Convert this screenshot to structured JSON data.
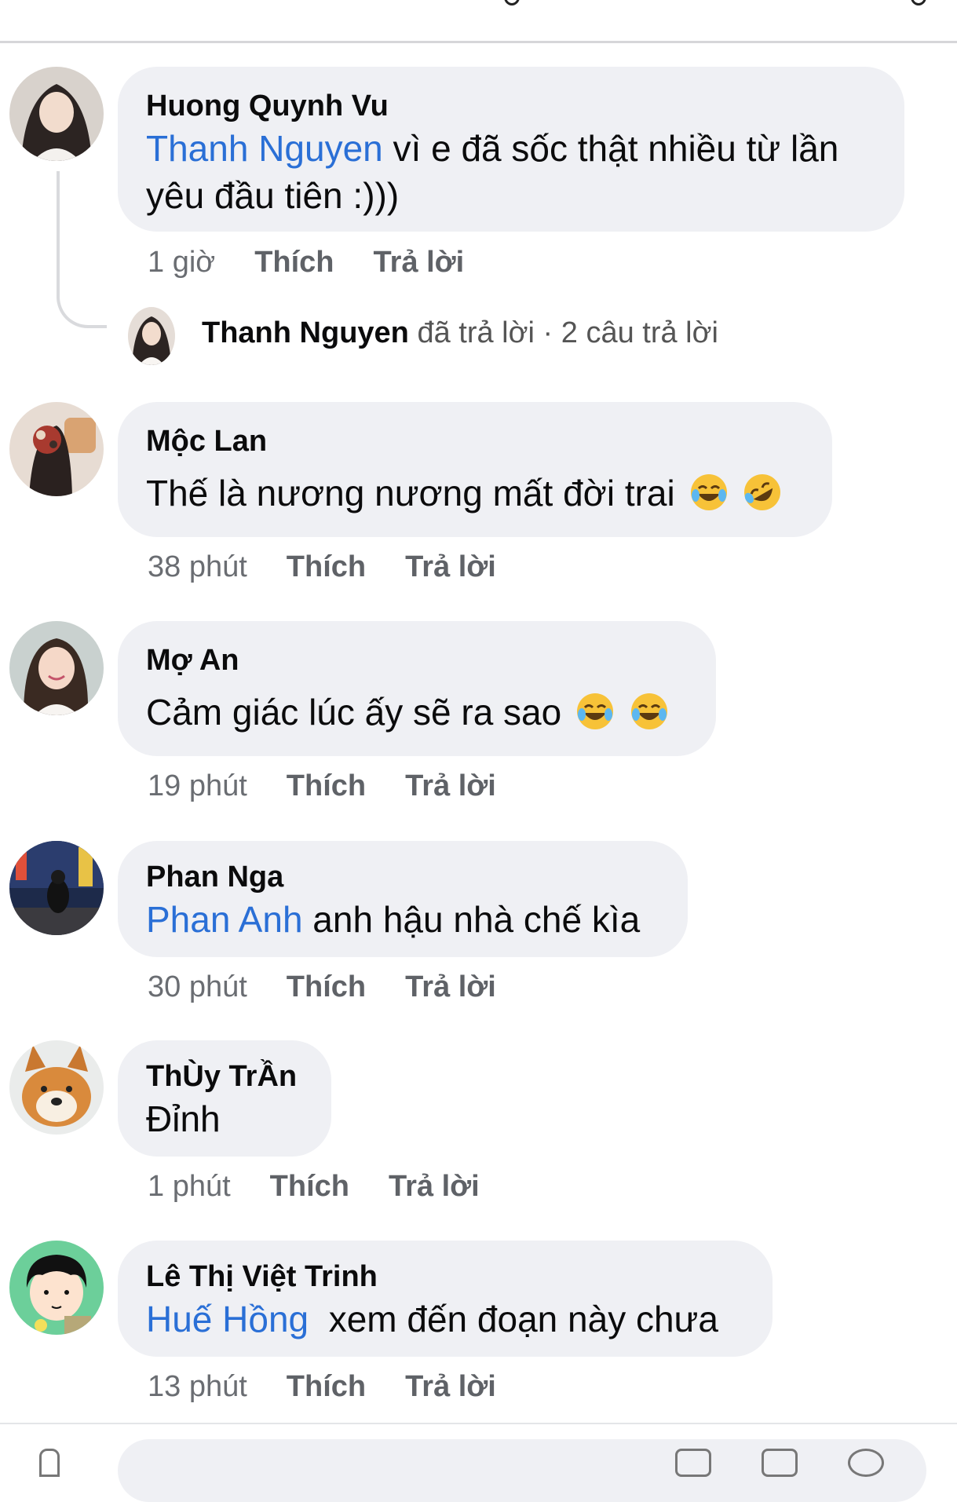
{
  "comments": [
    {
      "author": "Huong Quynh Vu",
      "mention": "Thanh Nguyen",
      "text": " vì e đã sốc thật nhiều từ lần yêu đầu tiên :)))",
      "time": "1 giờ",
      "like": "Thích",
      "reply": "Trả lời"
    },
    {
      "author": "Mộc Lan",
      "mention": "",
      "text": "Thế là nương nương mất đời trai",
      "emojis": [
        "face-with-tears-of-joy-icon",
        "rolling-on-floor-laughing-icon"
      ],
      "time": "38 phút",
      "like": "Thích",
      "reply": "Trả lời"
    },
    {
      "author": "Mợ An",
      "mention": "",
      "text": "Cảm giác lúc ấy sẽ ra sao",
      "emojis": [
        "face-with-tears-of-joy-icon",
        "face-with-tears-of-joy-icon"
      ],
      "time": "19 phút",
      "like": "Thích",
      "reply": "Trả lời"
    },
    {
      "author": "Phan Nga",
      "mention": "Phan Anh",
      "text": " anh hậu nhà chế kìa",
      "time": "30 phút",
      "like": "Thích",
      "reply": "Trả lời"
    },
    {
      "author": "ThÙy TrẦn",
      "mention": "",
      "text": "Đỉnh",
      "time": "1 phút",
      "like": "Thích",
      "reply": "Trả lời"
    },
    {
      "author": "Lê Thị Việt Trinh",
      "mention": "Huế Hồng",
      "text": "  xem đến đoạn này chưa",
      "time": "13 phút",
      "like": "Thích",
      "reply": "Trả lời"
    }
  ],
  "reply_summary": {
    "name": "Thanh Nguyen",
    "action": " đã trả lời",
    "count": " · 2 câu trả lời"
  },
  "colors": {
    "bubble": "#eff0f4",
    "mention": "#2a6fd6",
    "meta": "#6a6d72"
  }
}
